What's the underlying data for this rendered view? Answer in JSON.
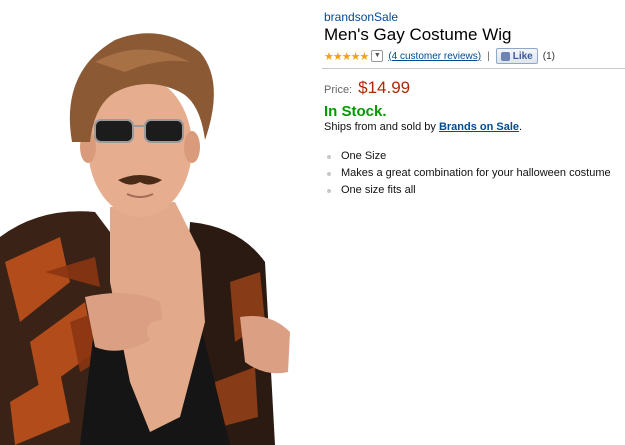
{
  "product": {
    "brand": "brandsonSale",
    "title": "Men's Gay Costume Wig",
    "rating_stars": "★★★★★",
    "reviews_link": "(4 customer reviews)",
    "separator": "|",
    "like_label": "Like",
    "like_count": "(1)",
    "price_label": "Price:",
    "price": "$14.99",
    "stock_status": "In Stock.",
    "ships_text": "Ships from and sold by",
    "seller": "Brands on Sale",
    "seller_suffix": ".",
    "bullets": [
      "One Size",
      "Makes a great combination for your halloween costume",
      "One size fits all"
    ]
  },
  "colors": {
    "link": "#004b91",
    "price": "#b12704",
    "in_stock": "#009900",
    "stars": "#f0a30a"
  }
}
